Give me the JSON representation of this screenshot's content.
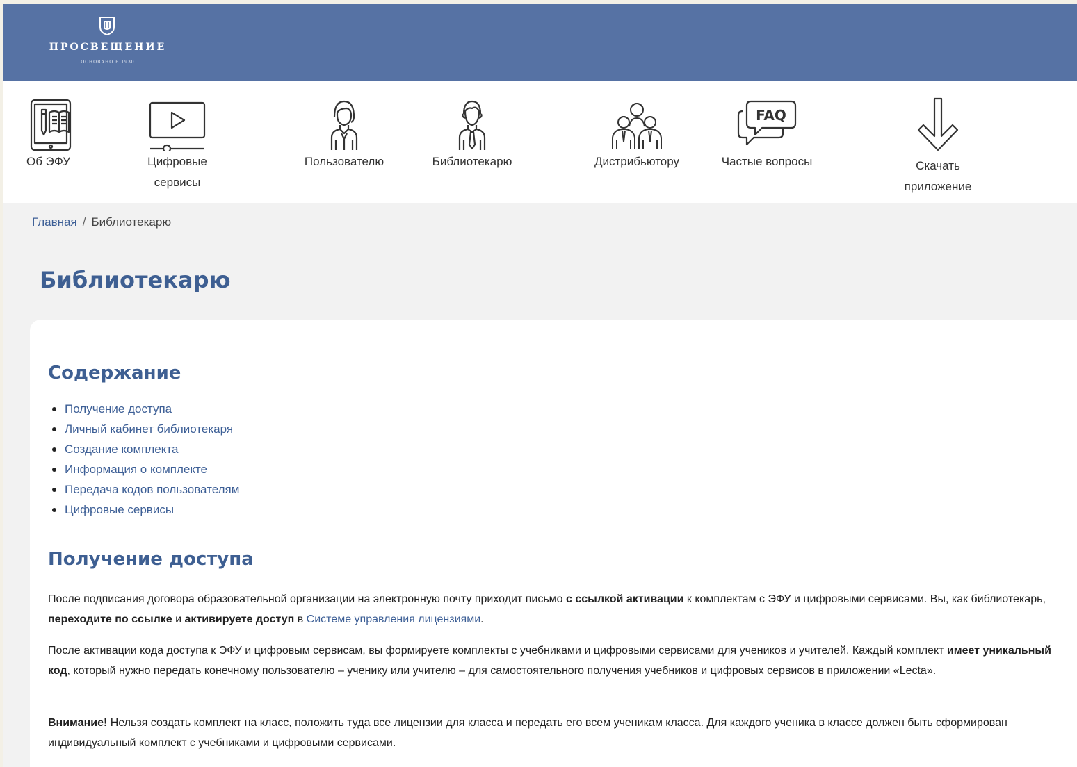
{
  "colors": {
    "header_bg": "#5672a4",
    "accent": "#3e5f92",
    "link": "#3d5f96",
    "page_bg": "#f2f2f2"
  },
  "logo": {
    "name": "ПРОСВЕЩЕНИЕ",
    "since": "ОСНОВАНО В 1930",
    "icon": "emblem-icon"
  },
  "nav": {
    "items": [
      {
        "label": "Об ЭФУ",
        "icon": "tablet-book-icon"
      },
      {
        "label": "Цифровые сервисы",
        "icon": "video-player-icon"
      },
      {
        "label": "Пользователю",
        "icon": "user-female-icon"
      },
      {
        "label": "Библиотекарю",
        "icon": "user-male-icon"
      },
      {
        "label": "Дистрибьютору",
        "icon": "group-icon"
      },
      {
        "label": "Частые вопросы",
        "icon": "faq-icon"
      },
      {
        "label": "Скачать приложение",
        "icon": "download-arrow-icon"
      }
    ]
  },
  "breadcrumb": {
    "home": "Главная",
    "separator": "/",
    "current": "Библиотекарю"
  },
  "page_title": "Библиотекарю",
  "toc": {
    "title": "Содержание",
    "items": [
      "Получение доступа",
      "Личный кабинет библиотекаря",
      "Создание комплекта",
      "Информация о комплекте",
      "Передача кодов пользователям",
      "Цифровые сервисы"
    ]
  },
  "section": {
    "title": "Получение доступа",
    "p1": {
      "t1": "После подписания договора образовательной организации на электронную почту приходит письмо ",
      "b1": "с ссылкой активации",
      "t2": " к комплектам с ЭФУ и цифровыми сервисами. Вы, как библиотекарь, ",
      "b2": "переходите по ссылке",
      "t3": " и ",
      "b3": "активируете доступ",
      "t4": " в ",
      "link": "Системе управления лицензиями",
      "t5": "."
    },
    "p2": {
      "t1": "После активации кода доступа к ЭФУ и цифровым сервисам, вы формируете комплекты с учебниками и цифровыми сервисами для учеников и учителей. Каждый комплект ",
      "b1": "имеет уникальный код",
      "t2": ", который нужно передать конечному пользователю – ученику или учителю – для самостоятельного получения учебников и цифровых сервисов в приложении «Lecta»."
    },
    "p3": {
      "b1": "Внимание!",
      "t1": " Нельзя создать комплект на класс, положить туда все лицензии для класса и передать его всем ученикам класса. Для каждого ученика в классе должен быть сформирован индивидуальный комплект с учебниками и цифровыми сервисами."
    }
  }
}
